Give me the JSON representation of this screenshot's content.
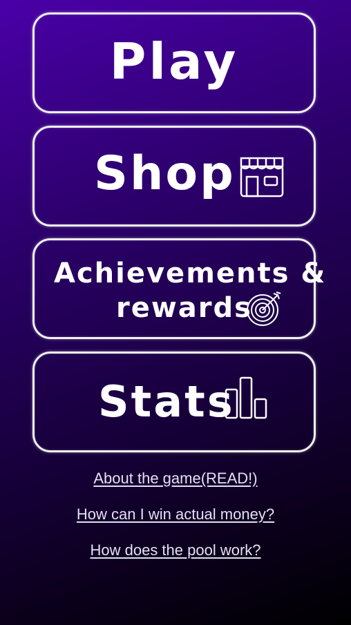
{
  "menu": {
    "play_label": "Play",
    "shop_label": "Shop",
    "achievements_line1": "Achievements &",
    "achievements_line2": "rewards",
    "stats_label": "Stats"
  },
  "icons": {
    "shop": "storefront-icon",
    "achievements": "target-arrow-icon",
    "stats": "bar-chart-icon"
  },
  "links": {
    "about": "About the game(READ!)",
    "money": "How can I win actual money?",
    "pool": "How does the pool work?"
  },
  "colors": {
    "background_top": "#4a00a8",
    "background_bottom": "#000000",
    "button_border": "#f2f2f2",
    "link_text": "#e6dff5"
  }
}
